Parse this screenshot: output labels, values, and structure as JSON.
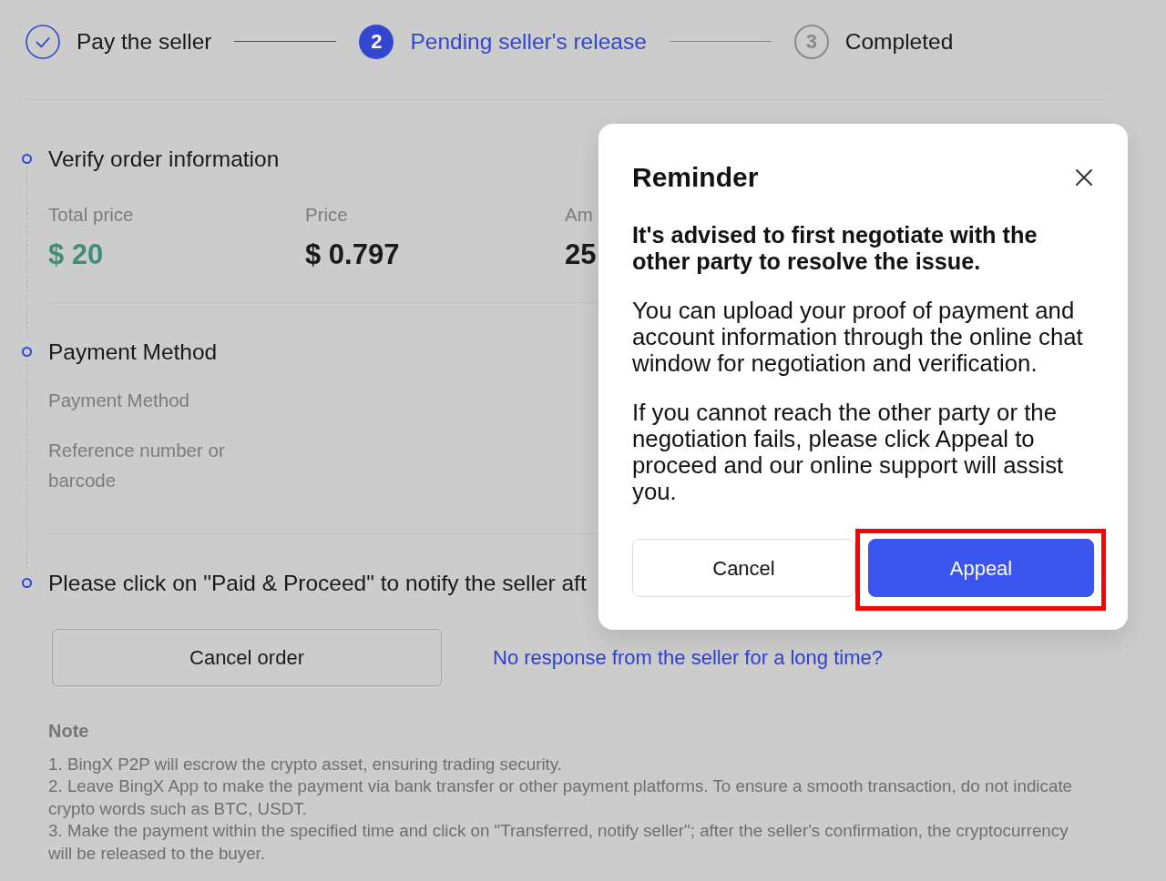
{
  "stepper": {
    "steps": [
      {
        "label": "Pay the seller",
        "completed": true,
        "selected": false
      },
      {
        "label": "Pending seller's release",
        "number": "2",
        "completed": false,
        "selected": true
      },
      {
        "label": "Completed",
        "number": "3",
        "completed": false,
        "selected": false
      }
    ]
  },
  "sections": [
    {
      "kind": "summary",
      "title": "Verify order information",
      "fields": [
        {
          "label": "Total price",
          "value": "$ 20",
          "accent": true
        },
        {
          "label": "Price",
          "value": "$ 0.797",
          "accent": false
        },
        {
          "label": "Am",
          "value": "25",
          "accent": false
        }
      ]
    },
    {
      "kind": "details",
      "title": "Payment Method",
      "fields": [
        {
          "label": "Payment Method"
        },
        {
          "label": "Reference number or barcode"
        }
      ]
    },
    {
      "kind": "action",
      "title": "Please click on \"Paid & Proceed\" to notify the seller aft",
      "button": "Cancel order",
      "link": "No response from the seller for a long time?"
    }
  ],
  "note": {
    "title": "Note",
    "items": [
      "1. BingX P2P will escrow the crypto asset, ensuring trading security.",
      "2. Leave BingX App to make the payment via bank transfer or other payment platforms. To ensure a smooth transaction, do not indicate crypto words such as BTC, USDT.",
      "3. Make the payment within the specified time and click on \"Transferred, notify seller\"; after the seller's confirmation, the cryptocurrency will be released to the buyer."
    ]
  },
  "modal": {
    "title": "Reminder",
    "lead": "It's advised to first negotiate with the other party to resolve the issue.",
    "paragraphs": [
      "You can upload your proof of payment and account information through the online chat window for negotiation and verification.",
      "If you cannot reach the other party or the negotiation fails, please click Appeal to proceed and our online support will assist you."
    ],
    "buttons": [
      {
        "label": "Cancel",
        "kind": "secondary",
        "highlighted": false
      },
      {
        "label": "Appeal",
        "kind": "primary",
        "highlighted": true
      }
    ]
  }
}
